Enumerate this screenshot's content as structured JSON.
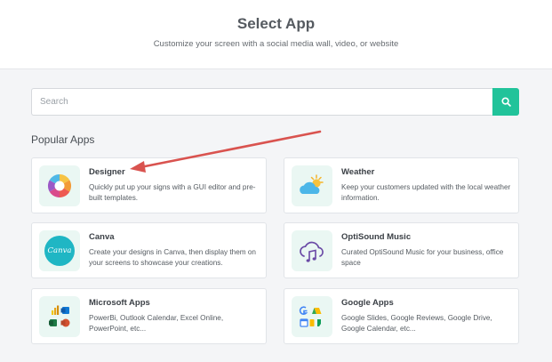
{
  "header": {
    "title": "Select App",
    "subtitle": "Customize your screen with a social media wall, video, or website"
  },
  "search": {
    "placeholder": "Search",
    "value": ""
  },
  "section": {
    "title": "Popular Apps"
  },
  "apps": [
    {
      "name": "Designer",
      "desc": "Quickly put up your signs with a GUI editor and pre-built templates.",
      "icon": "designer-icon"
    },
    {
      "name": "Weather",
      "desc": "Keep your customers updated with the local weather information.",
      "icon": "weather-icon"
    },
    {
      "name": "Canva",
      "desc": "Create your designs in Canva, then display them on your screens to showcase your creations.",
      "icon": "canva-icon"
    },
    {
      "name": "OptiSound Music",
      "desc": "Curated OptiSound Music for your business, office space",
      "icon": "music-cloud-icon"
    },
    {
      "name": "Microsoft Apps",
      "desc": "PowerBi, Outlook Calendar, Excel Online, PowerPoint, etc...",
      "icon": "microsoft-apps-icon"
    },
    {
      "name": "Google Apps",
      "desc": "Google Slides, Google Reviews, Google Drive, Google Calendar, etc...",
      "icon": "google-apps-icon"
    }
  ],
  "canva_logo_text": "Canva",
  "colors": {
    "accent": "#21c39a",
    "arrow": "#d9534f"
  }
}
